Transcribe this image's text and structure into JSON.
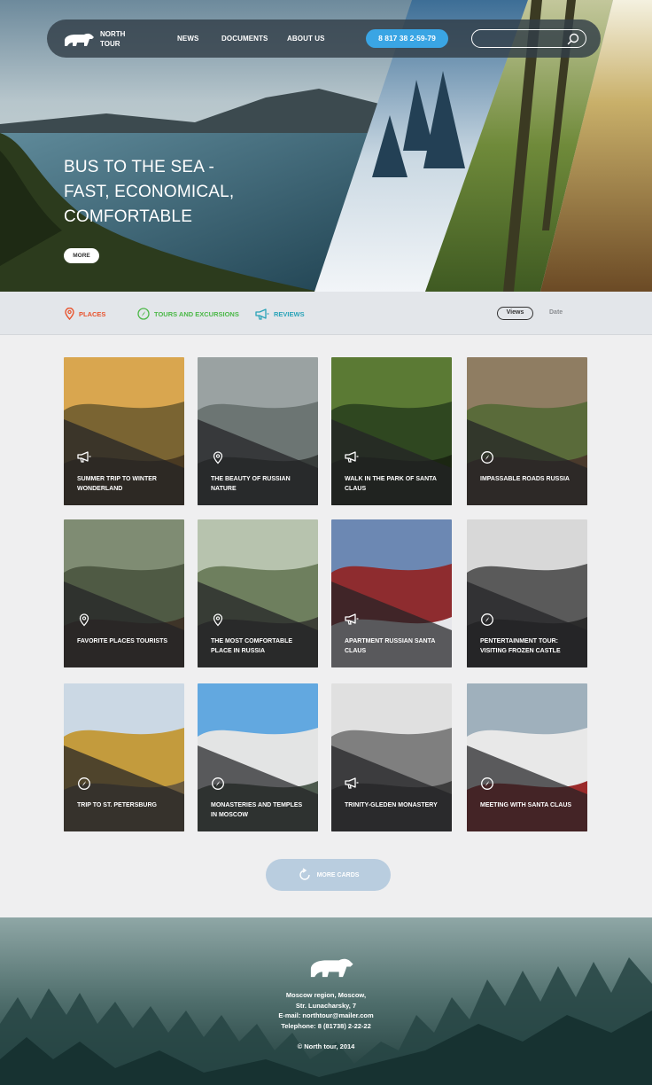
{
  "brand": {
    "name_line1": "NORTH",
    "name_line2": "TOUR"
  },
  "nav": {
    "links": [
      "NEWS",
      "DOCUMENTS",
      "ABOUT US"
    ],
    "phone": "8 817 38 2-59-79",
    "search_placeholder": ""
  },
  "hero": {
    "title_lines": [
      "BUS TO THE SEA -",
      "FAST, ECONOMICAL,",
      "COMFORTABLE"
    ],
    "more_label": "MORE"
  },
  "filters": {
    "items": [
      {
        "label": "PLACES",
        "icon": "map-pin-icon",
        "color": "#e8542e"
      },
      {
        "label": "TOURS AND EXCURSIONS",
        "icon": "compass-icon",
        "color": "#4cb848"
      },
      {
        "label": "REVIEWS",
        "icon": "megaphone-icon",
        "color": "#2aa3b8"
      }
    ],
    "sort": {
      "views_label": "Views",
      "date_label": "Date"
    }
  },
  "cards": [
    {
      "title": "SUMMER TRIP TO WINTER WONDERLAND",
      "icon": "megaphone-icon"
    },
    {
      "title": "THE BEAUTY OF RUSSIAN NATURE",
      "icon": "map-pin-icon"
    },
    {
      "title": "WALK IN THE PARK OF SANTA CLAUS",
      "icon": "megaphone-icon"
    },
    {
      "title": "IMPASSABLE ROADS RUSSIA",
      "icon": "compass-icon"
    },
    {
      "title": "FAVORITE PLACES TOURISTS",
      "icon": "map-pin-icon"
    },
    {
      "title": "THE MOST COMFORTABLE PLACE IN RUSSIA",
      "icon": "map-pin-icon"
    },
    {
      "title": "APARTMENT RUSSIAN SANTA CLAUS",
      "icon": "megaphone-icon"
    },
    {
      "title": "PENTERTAINMENT TOUR: VISITING FROZEN CASTLE",
      "icon": "compass-icon"
    },
    {
      "title": "TRIP TO ST. PETERSBURG",
      "icon": "compass-icon"
    },
    {
      "title": "MONASTERIES AND TEMPLES IN MOSCOW",
      "icon": "compass-icon"
    },
    {
      "title": "TRINITY-GLEDEN MONASTERY",
      "icon": "megaphone-icon"
    },
    {
      "title": "MEETING WITH SANTA CLAUS",
      "icon": "compass-icon"
    }
  ],
  "more_cards_label": "MORE CARDS",
  "footer": {
    "address_line1": "Moscow region, Moscow,",
    "address_line2": "Str. Lunacharsky, 7",
    "email": "E-mail:  northtour@mailer.com",
    "phone": "Telephone:  8 (81738) 2-22-22",
    "copyright": "© North tour,  2014"
  },
  "colors": {
    "accent_blue": "#3aa5e4",
    "places": "#e8542e",
    "tours": "#4cb848",
    "reviews": "#2aa3b8"
  }
}
